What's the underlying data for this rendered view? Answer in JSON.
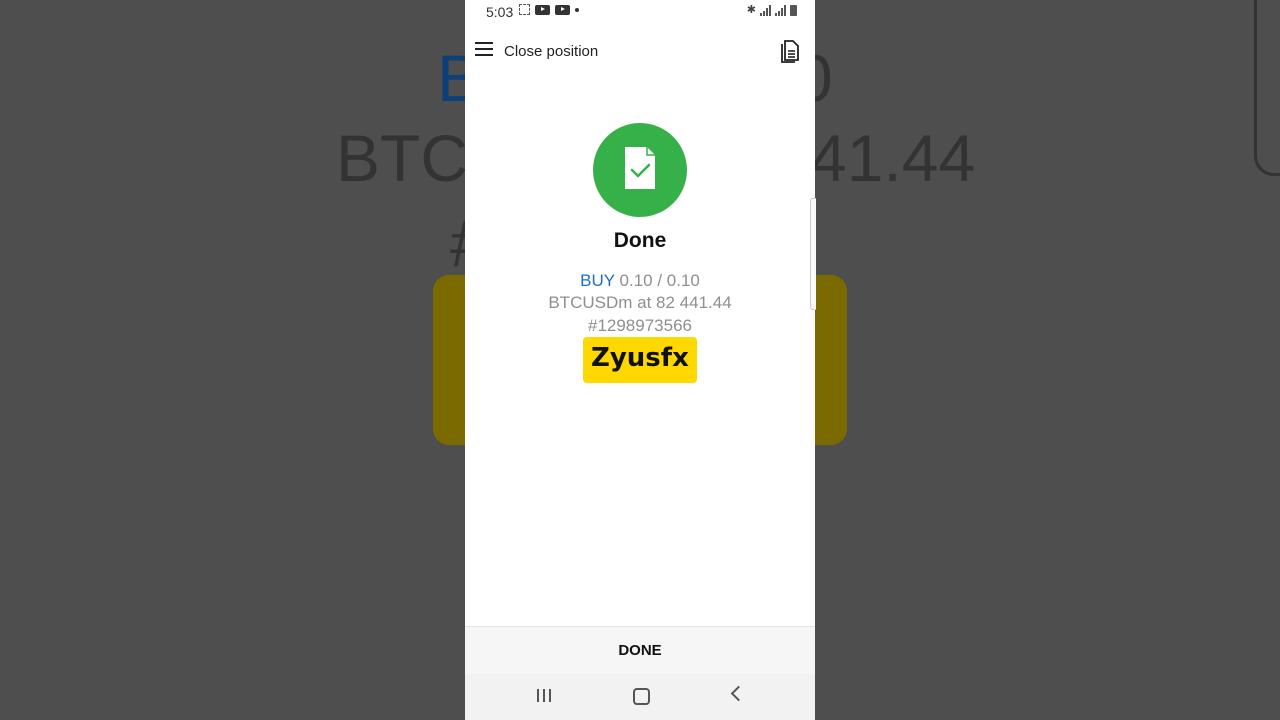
{
  "status_bar": {
    "time": "5:03"
  },
  "app_bar": {
    "title": "Close position"
  },
  "result": {
    "title": "Done",
    "direction": "BUY",
    "volume": "0.10 / 0.10",
    "symbol_price": "BTCUSDm at 82 441.44",
    "ticket": "#1298973566"
  },
  "watermark": {
    "text": "Zyusfx"
  },
  "footer": {
    "done_label": "DONE"
  },
  "colors": {
    "success": "#36b14a",
    "buy": "#1f6fc0",
    "watermark_bg": "#ffd800"
  }
}
